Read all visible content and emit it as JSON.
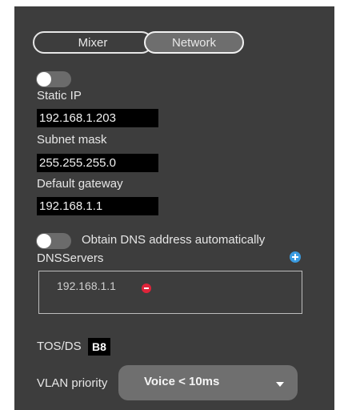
{
  "tabs": [
    {
      "label": "Mixer"
    },
    {
      "label": "Network"
    }
  ],
  "network": {
    "static_ip_label": "Static IP",
    "static_ip_value": "192.168.1.203",
    "subnet_label": "Subnet mask",
    "subnet_value": "255.255.255.0",
    "gateway_label": "Default gateway",
    "gateway_value": "192.168.1.1",
    "dns_auto_label": "Obtain DNS address automatically",
    "dns_servers_label": "DNSServers",
    "dns_servers": [
      "192.168.1.1"
    ],
    "tos_label": "TOS/DS",
    "tos_value": "B8",
    "vlan_label": "VLAN priority",
    "vlan_value": "Voice < 10ms"
  },
  "colors": {
    "panel_bg": "#3d3d3d",
    "field_bg": "#000000",
    "remove_red": "#e0243a",
    "add_blue": "#3a9be0"
  }
}
